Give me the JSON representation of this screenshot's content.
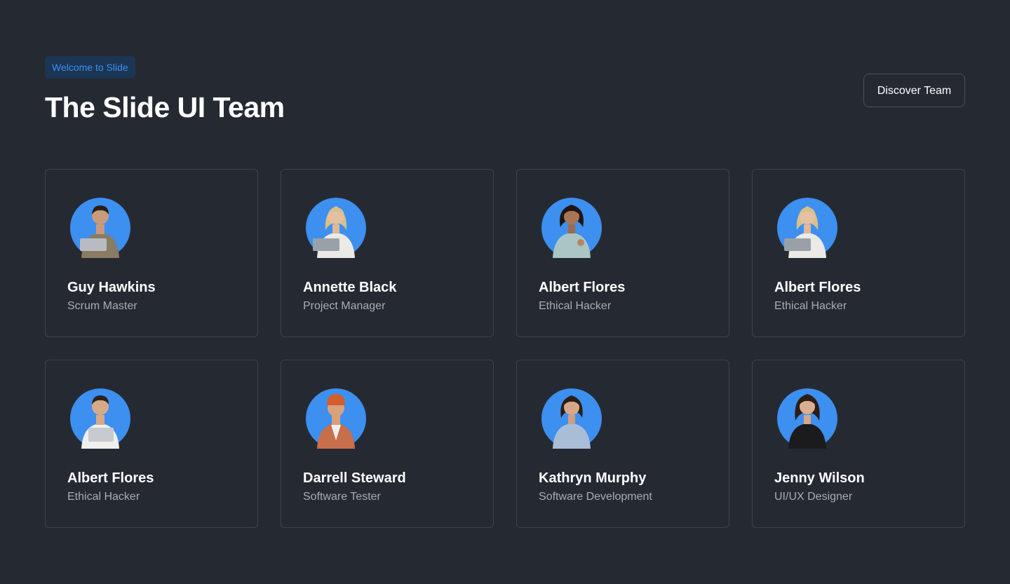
{
  "header": {
    "badge": "Welcome to Slide",
    "title": "The Slide UI Team",
    "discover_label": "Discover Team"
  },
  "colors": {
    "background": "#252a32",
    "accent": "#3d8ff0",
    "avatar_bg": "#3d8ff0",
    "card_border": "#3c424c"
  },
  "team": [
    {
      "name": "Guy Hawkins",
      "role": "Scrum Master",
      "avatar": "man-with-laptop-avatar"
    },
    {
      "name": "Annette Black",
      "role": "Project Manager",
      "avatar": "woman-with-laptop-avatar"
    },
    {
      "name": "Albert Flores",
      "role": "Ethical Hacker",
      "avatar": "woman-curly-hair-avatar"
    },
    {
      "name": "Albert Flores",
      "role": "Ethical Hacker",
      "avatar": "woman-with-laptop-avatar"
    },
    {
      "name": "Albert Flores",
      "role": "Ethical Hacker",
      "avatar": "man-with-laptop-avatar"
    },
    {
      "name": "Darrell Steward",
      "role": "Software Tester",
      "avatar": "man-with-beanie-avatar"
    },
    {
      "name": "Kathryn Murphy",
      "role": "Software Development",
      "avatar": "woman-with-glasses-avatar"
    },
    {
      "name": "Jenny Wilson",
      "role": "UI/UX Designer",
      "avatar": "woman-dark-hair-avatar"
    }
  ]
}
